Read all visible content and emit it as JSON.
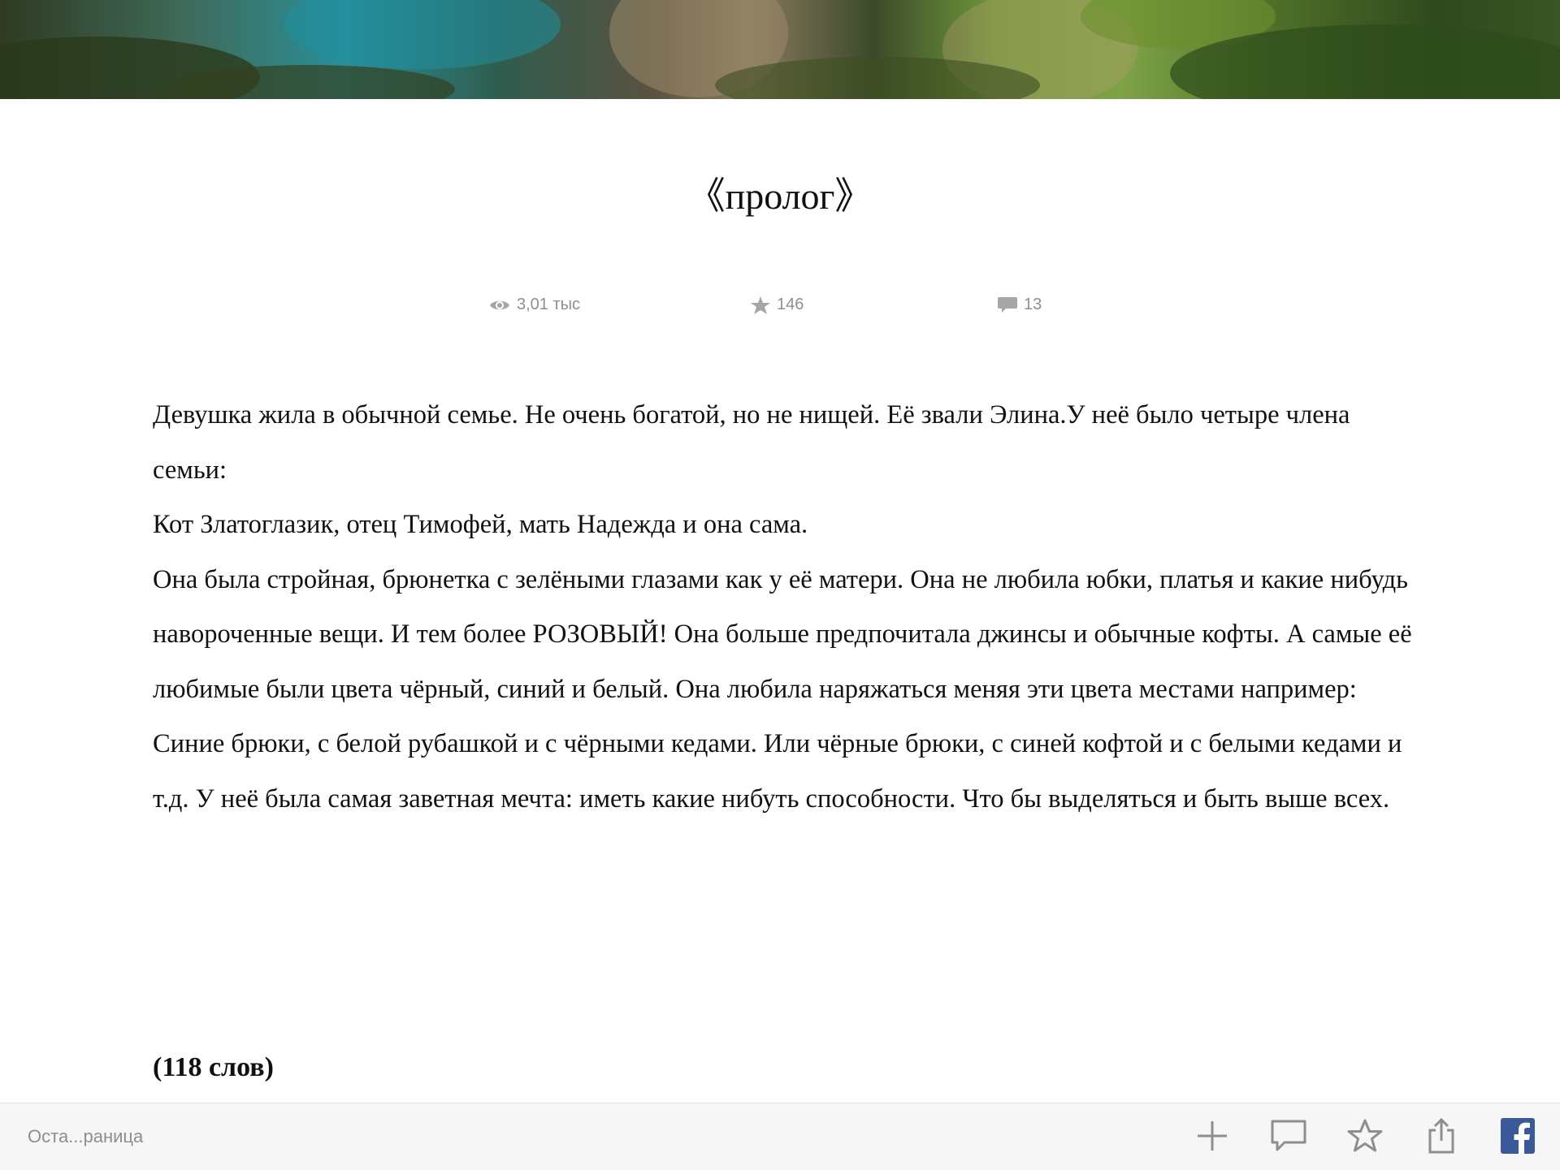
{
  "chapter": {
    "title": "《пролог》"
  },
  "stats": {
    "views": "3,01 тыс",
    "votes": "146",
    "comments": "13"
  },
  "content": {
    "paragraphs": [
      "Девушка жила в обычной семье. Не очень богатой, но не нищей. Её звали Элина.У неё было четыре члена семьи:",
      "Кот Златоглазик, отец Тимофей, мать Надежда и она сама.",
      "Она была стройная, брюнетка с зелёными глазами как у её матери. Она не любила юбки, платья и какие нибудь навороченные вещи. И тем более РОЗОВЫЙ! Она больше предпочитала джинсы и обычные кофты. А самые её любимые были цвета чёрный, синий и белый. Она любила наряжаться меняя эти цвета местами например:",
      "Синие брюки, с белой рубашкой и с чёрными кедами. Или чёрные брюки, с синей кофтой и с белыми кедами и т.д. У неё была самая заветная мечта: иметь какие нибуть способности. Что бы выделяться и быть выше всех."
    ],
    "word_count": "(118 слов)"
  },
  "toolbar": {
    "page_label": "Оста...раница",
    "buttons": [
      {
        "icon": "plus-icon"
      },
      {
        "icon": "comment-icon"
      },
      {
        "icon": "star-icon"
      },
      {
        "icon": "share-icon"
      },
      {
        "icon": "facebook-icon"
      }
    ]
  },
  "colors": {
    "facebook": "#3b5998",
    "muted_icon": "#8e8e8e",
    "toolbar_bg": "#f6f6f6"
  }
}
